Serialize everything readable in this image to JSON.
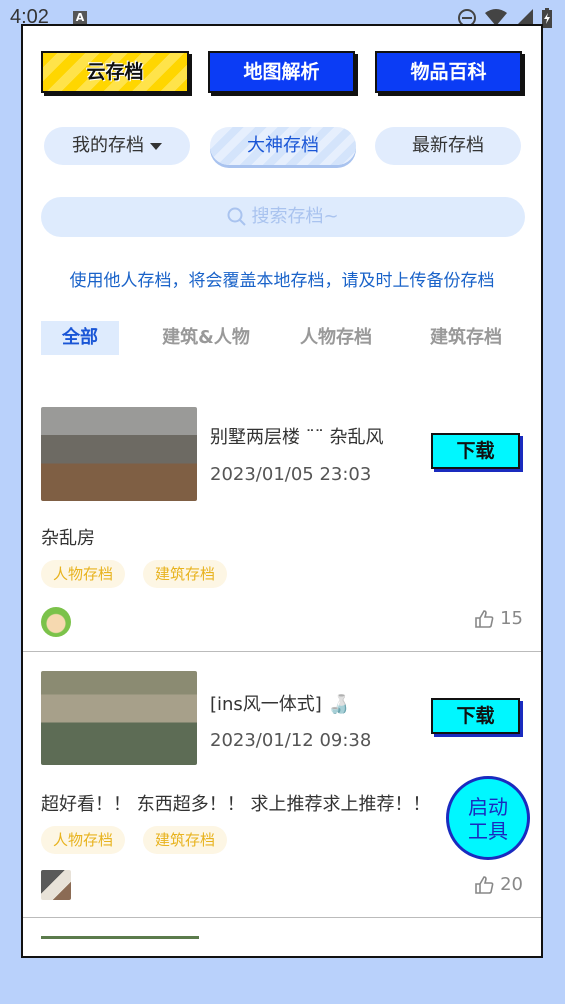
{
  "status_bar": {
    "time": "4:02",
    "notif_letter": "A"
  },
  "top_buttons": {
    "cloud": "云存档",
    "map": "地图解析",
    "items": "物品百科"
  },
  "filters": {
    "mine": "我的存档",
    "pro": "大神存档",
    "latest": "最新存档"
  },
  "search": {
    "placeholder": "搜索存档~"
  },
  "notice": "使用他人存档，将会覆盖本地存档，请及时上传备份存档",
  "tabs": [
    "全部",
    "建筑&人物",
    "人物存档",
    "建筑存档"
  ],
  "cards": [
    {
      "title": "别墅两层楼 ¨¨ 杂乱风",
      "date": "2023/01/05 23:03",
      "download": "下载",
      "desc": "杂乱房",
      "tags": [
        "人物存档",
        "建筑存档"
      ],
      "likes": "15"
    },
    {
      "title": "[ins风一体式] 🍶",
      "date": "2023/01/12 09:38",
      "download": "下载",
      "desc": "超好看！！ 东西超多！！ 求上推荐求上推荐！！",
      "tags": [
        "人物存档",
        "建筑存档"
      ],
      "likes": "20"
    }
  ],
  "fab": {
    "line1": "启动",
    "line2": "工具"
  }
}
